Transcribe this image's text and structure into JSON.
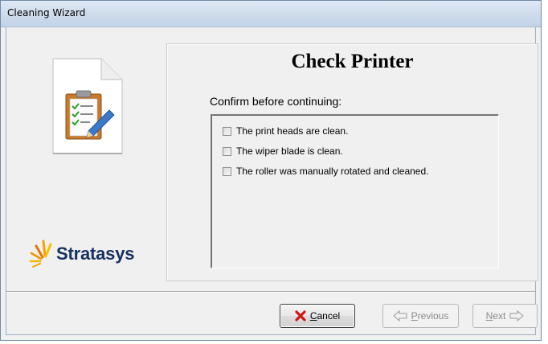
{
  "window": {
    "title": "Cleaning Wizard"
  },
  "sidebar": {
    "logo_text": "Stratasys",
    "document_icon": "clipboard-checklist-icon"
  },
  "panel": {
    "title": "Check Printer",
    "confirm_label": "Confirm before continuing:",
    "items": [
      {
        "label": "The print heads are clean.",
        "checked": false
      },
      {
        "label": "The wiper blade is clean.",
        "checked": false
      },
      {
        "label": "The roller was manually rotated and cleaned.",
        "checked": false
      }
    ]
  },
  "buttons": {
    "cancel": {
      "accel": "C",
      "rest": "ancel",
      "icon": "red-x-icon",
      "enabled": true
    },
    "previous": {
      "accel": "P",
      "rest": "revious",
      "icon": "left-arrow-icon",
      "enabled": false
    },
    "next": {
      "accel": "N",
      "rest": "ext",
      "icon": "right-arrow-icon",
      "enabled": false
    }
  },
  "colors": {
    "title_bar": "#cfdceb",
    "logo_text": "#15315f",
    "cancel_icon": "#d01818"
  }
}
